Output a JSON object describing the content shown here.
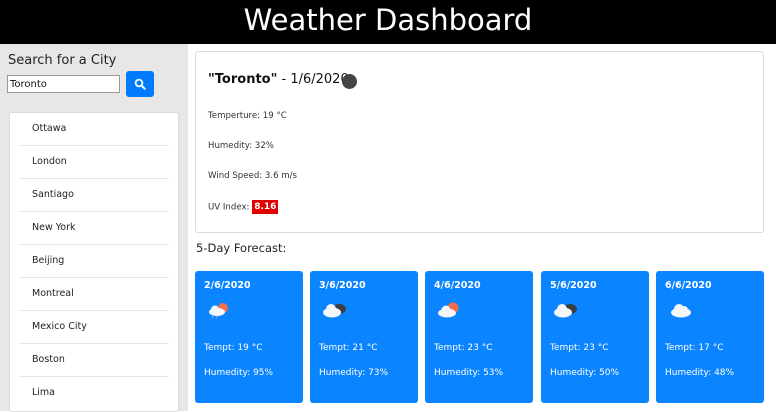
{
  "header": {
    "title": "Weather Dashboard"
  },
  "search": {
    "title": "Search for a City",
    "value": "Toronto",
    "button_icon": "search-icon"
  },
  "cities": [
    "Ottawa",
    "London",
    "Santiago",
    "New York",
    "Beijing",
    "Montreal",
    "Mexico City",
    "Boston",
    "Lima"
  ],
  "current": {
    "city": "\"Toronto\"",
    "date": " - 1/6/2020",
    "icon": "dark-circle-icon",
    "temperature": "Temperture: 19 °C",
    "humidity": "Humedity: 32%",
    "wind": "Wind Speed: 3.6 m/s",
    "uv_label": "UV Index: ",
    "uv_value": "8.16",
    "uv_color": "#e00000"
  },
  "forecast": {
    "title": "5-Day Forecast:",
    "card_color": "#0a84ff",
    "days": [
      {
        "date": "2/6/2020",
        "icon": "sun-rain-cloud-icon",
        "temp": "Tempt: 19 °C",
        "humidity": "Humedity: 95%"
      },
      {
        "date": "3/6/2020",
        "icon": "dark-cloud-icon",
        "temp": "Tempt: 21 °C",
        "humidity": "Humedity: 73%"
      },
      {
        "date": "4/6/2020",
        "icon": "sun-cloud-icon",
        "temp": "Tempt: 23 °C",
        "humidity": "Humedity: 53%"
      },
      {
        "date": "5/6/2020",
        "icon": "dark-cloud-icon",
        "temp": "Tempt: 23 °C",
        "humidity": "Humedity: 50%"
      },
      {
        "date": "6/6/2020",
        "icon": "cloud-icon",
        "temp": "Tempt: 17 °C",
        "humidity": "Humedity: 48%"
      }
    ]
  }
}
